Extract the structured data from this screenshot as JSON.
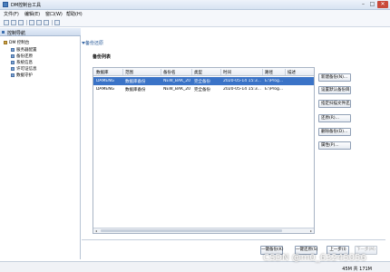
{
  "window": {
    "title": "DM控制台工具",
    "minimize": "–",
    "maximize": "□",
    "close": "✕"
  },
  "menu": [
    "文件(F)",
    "编辑(E)",
    "窗口(W)",
    "帮助(H)"
  ],
  "left_panel": {
    "tab_label": "控制导航",
    "root": "DM 控制台",
    "items": [
      "服务器配置",
      "备份还原",
      "系统信息",
      "许可证信息",
      "数据守护"
    ]
  },
  "right_panel": {
    "section_title": "备份还原",
    "list_title": "备份列表",
    "columns": [
      "数据库",
      "范围",
      "备份名",
      "类型",
      "时间",
      "路径",
      "描述"
    ],
    "rows": [
      [
        "DAMENG",
        "数据库备份",
        "NEW_BAK_20",
        "完全备份",
        "2020-05-14 15:3...",
        "E:\\Prog...",
        ""
      ],
      [
        "DAMENG",
        "数据库备份",
        "NEW_BAK_20",
        "完全备份",
        "2020-05-14 15:3...",
        "E:\\Prog...",
        ""
      ]
    ],
    "side_buttons": [
      "新建备份(N)...",
      "设置默认备份目录(...",
      "指定扫描文件还原(...",
      "还原(R)...",
      "删除备份(D)...",
      "属性(P)..."
    ],
    "bottom_buttons": [
      "一键备份(K)",
      "一键还原(S)",
      "上一步(I)",
      "下一步(M)"
    ]
  },
  "status": {
    "memory": "45M 共 171M"
  },
  "watermark": "CSDN @m0_63245056"
}
